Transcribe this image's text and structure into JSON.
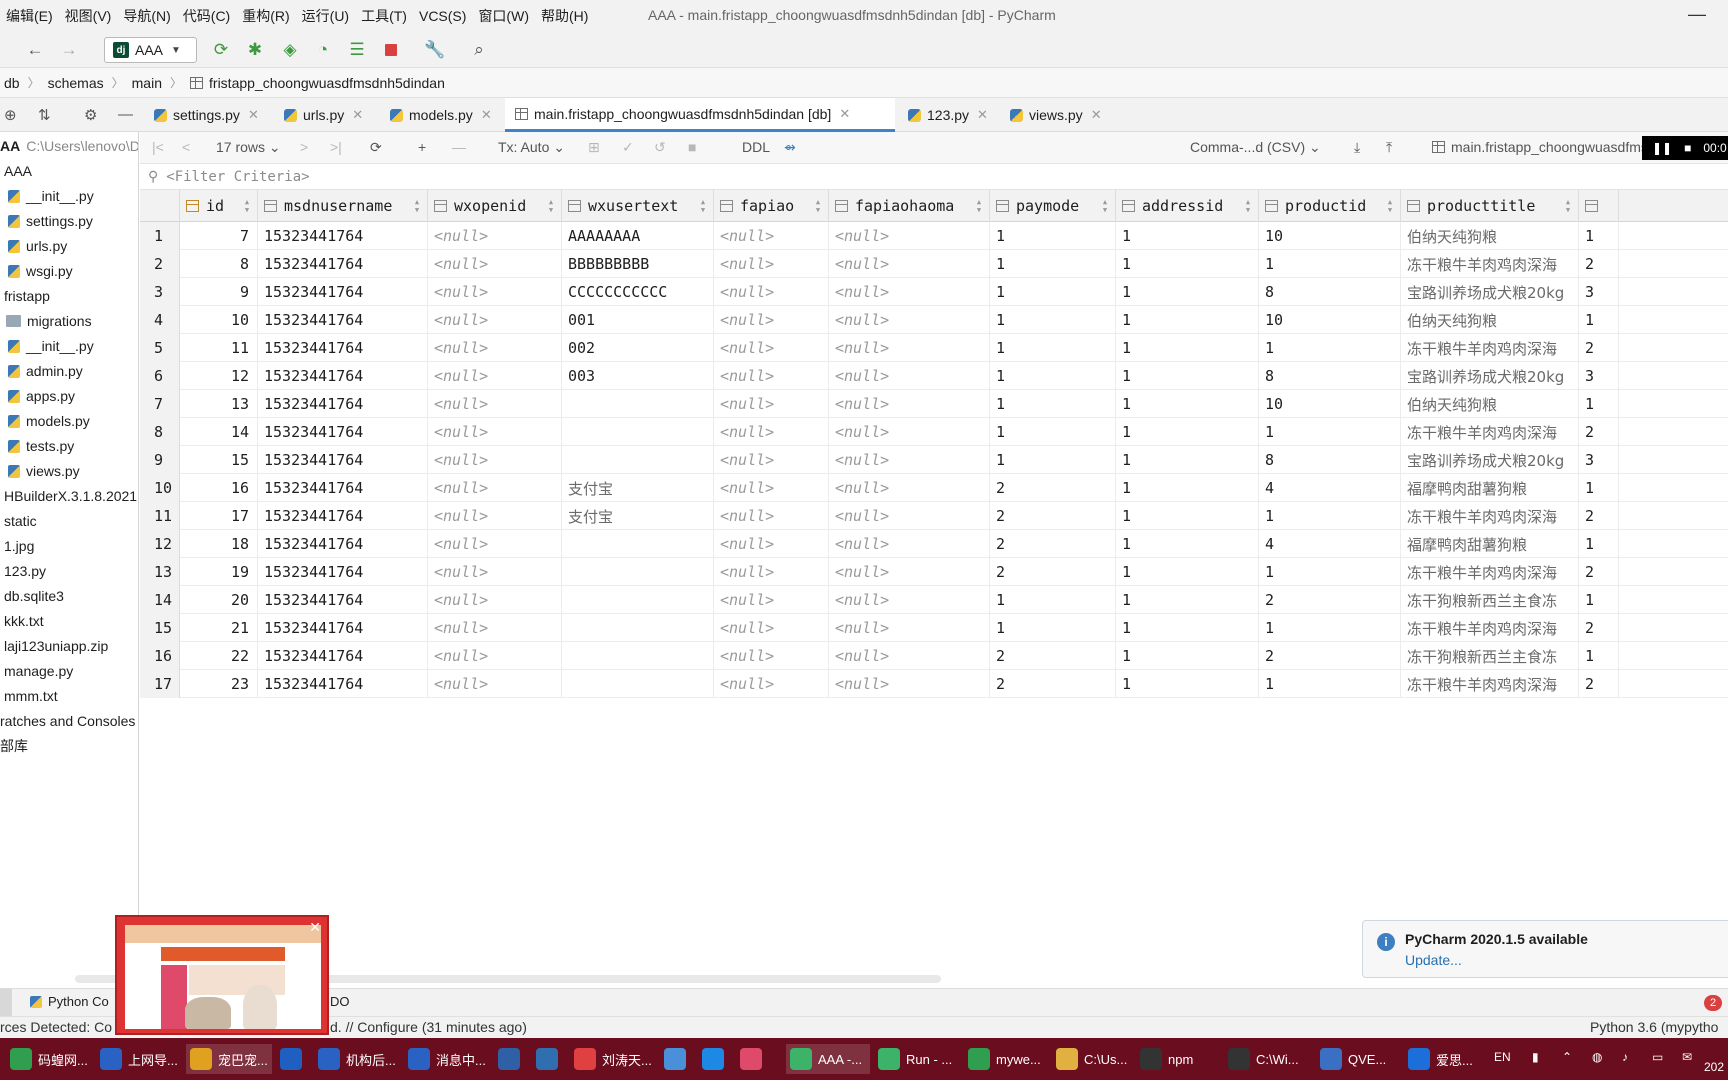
{
  "menu": {
    "items": [
      "编辑(E)",
      "视图(V)",
      "导航(N)",
      "代码(C)",
      "重构(R)",
      "运行(U)",
      "工具(T)",
      "VCS(S)",
      "窗口(W)",
      "帮助(H)"
    ],
    "window_title": "AAA - main.fristapp_choongwuasdfmsdnh5dindan [db] - PyCharm"
  },
  "toolbar": {
    "run_config": "AAA",
    "icons": [
      "back-icon",
      "forward-icon",
      "rerun-icon",
      "debug-icon",
      "coverage-icon",
      "profile-icon",
      "build-icon",
      "stop-icon",
      "wrench-icon",
      "search-icon"
    ]
  },
  "breadcrumb": [
    "db",
    "schemas",
    "main",
    "fristapp_choongwuasdfmsdnh5dindan"
  ],
  "tabs": [
    {
      "label": "settings.py",
      "active": false
    },
    {
      "label": "urls.py",
      "active": false
    },
    {
      "label": "models.py",
      "active": false
    },
    {
      "label": "main.fristapp_choongwuasdfmsdnh5dindan [db]",
      "active": true
    },
    {
      "label": "123.py",
      "active": false
    },
    {
      "label": "views.py",
      "active": false
    }
  ],
  "sidebar": {
    "root_label": "AA",
    "root_path": "C:\\Users\\lenovo\\D",
    "items": [
      "AAA",
      "__init__.py",
      "settings.py",
      "urls.py",
      "wsgi.py",
      "fristapp",
      "migrations",
      "__init__.py",
      "admin.py",
      "apps.py",
      "models.py",
      "tests.py",
      "views.py",
      "HBuilderX.3.1.8.2021",
      "static",
      "1.jpg",
      "123.py",
      "db.sqlite3",
      "kkk.txt",
      "laji123uniapp.zip",
      "manage.py",
      "mmm.txt",
      "ratches and Consoles",
      "部库"
    ]
  },
  "gridbar": {
    "rows_label": "17 rows",
    "tx_label": "Tx: Auto",
    "ddl_label": "DDL",
    "export_label": "Comma-...d (CSV)",
    "table_label": "main.fristapp_choongwuasdfmsd",
    "timer": "00:0"
  },
  "filter": {
    "placeholder": "<Filter Criteria>"
  },
  "grid": {
    "columns": [
      "id",
      "msdnusername",
      "wxopenid",
      "wxusertext",
      "fapiao",
      "fapiaohaoma",
      "paymode",
      "addressid",
      "productid",
      "producttitle"
    ],
    "rows": [
      [
        "7",
        "15323441764",
        "<null>",
        "AAAAAAAA",
        "<null>",
        "<null>",
        "1",
        "1",
        "10",
        "伯纳天纯狗粮",
        "1"
      ],
      [
        "8",
        "15323441764",
        "<null>",
        "BBBBBBBBB",
        "<null>",
        "<null>",
        "1",
        "1",
        "1",
        "冻干粮牛羊肉鸡肉深海",
        "2"
      ],
      [
        "9",
        "15323441764",
        "<null>",
        "CCCCCCCCCCC",
        "<null>",
        "<null>",
        "1",
        "1",
        "8",
        "宝路训养场成犬粮20kg",
        "3"
      ],
      [
        "10",
        "15323441764",
        "<null>",
        "001",
        "<null>",
        "<null>",
        "1",
        "1",
        "10",
        "伯纳天纯狗粮",
        "1"
      ],
      [
        "11",
        "15323441764",
        "<null>",
        "002",
        "<null>",
        "<null>",
        "1",
        "1",
        "1",
        "冻干粮牛羊肉鸡肉深海",
        "2"
      ],
      [
        "12",
        "15323441764",
        "<null>",
        "003",
        "<null>",
        "<null>",
        "1",
        "1",
        "8",
        "宝路训养场成犬粮20kg",
        "3"
      ],
      [
        "13",
        "15323441764",
        "<null>",
        "",
        "<null>",
        "<null>",
        "1",
        "1",
        "10",
        "伯纳天纯狗粮",
        "1"
      ],
      [
        "14",
        "15323441764",
        "<null>",
        "",
        "<null>",
        "<null>",
        "1",
        "1",
        "1",
        "冻干粮牛羊肉鸡肉深海",
        "2"
      ],
      [
        "15",
        "15323441764",
        "<null>",
        "",
        "<null>",
        "<null>",
        "1",
        "1",
        "8",
        "宝路训养场成犬粮20kg",
        "3"
      ],
      [
        "16",
        "15323441764",
        "<null>",
        "支付宝",
        "<null>",
        "<null>",
        "2",
        "1",
        "4",
        "福摩鸭肉甜薯狗粮",
        "1"
      ],
      [
        "17",
        "15323441764",
        "<null>",
        "支付宝",
        "<null>",
        "<null>",
        "2",
        "1",
        "1",
        "冻干粮牛羊肉鸡肉深海",
        "2"
      ],
      [
        "18",
        "15323441764",
        "<null>",
        "",
        "<null>",
        "<null>",
        "2",
        "1",
        "4",
        "福摩鸭肉甜薯狗粮",
        "1"
      ],
      [
        "19",
        "15323441764",
        "<null>",
        "",
        "<null>",
        "<null>",
        "2",
        "1",
        "1",
        "冻干粮牛羊肉鸡肉深海",
        "2"
      ],
      [
        "20",
        "15323441764",
        "<null>",
        "",
        "<null>",
        "<null>",
        "1",
        "1",
        "2",
        "冻干狗粮新西兰主食冻",
        "1"
      ],
      [
        "21",
        "15323441764",
        "<null>",
        "",
        "<null>",
        "<null>",
        "1",
        "1",
        "1",
        "冻干粮牛羊肉鸡肉深海",
        "2"
      ],
      [
        "22",
        "15323441764",
        "<null>",
        "",
        "<null>",
        "<null>",
        "2",
        "1",
        "2",
        "冻干狗粮新西兰主食冻",
        "1"
      ],
      [
        "23",
        "15323441764",
        "<null>",
        "",
        "<null>",
        "<null>",
        "2",
        "1",
        "1",
        "冻干粮牛羊肉鸡肉深海",
        "2"
      ]
    ]
  },
  "notification": {
    "title": "PyCharm 2020.1.5 available",
    "link": "Update..."
  },
  "bottom": {
    "python_console": "Python Co",
    "todo_fragment": "DO",
    "error_count": "2"
  },
  "status": {
    "left": "rces Detected: Co",
    "middle": "d. // Configure (31 minutes ago)",
    "right": "Python 3.6 (mypytho"
  },
  "taskbar": {
    "items": [
      "码蝗网...",
      "上网导...",
      "宠巴宠...",
      "",
      "机构后...",
      "消息中...",
      "",
      "",
      "刘涛天...",
      "",
      "",
      "",
      "AAA -...",
      "Run - ...",
      "mywe...",
      "C:\\Us...",
      "npm",
      "C:\\Wi...",
      "QVE...",
      "爱思..."
    ],
    "lang": "EN",
    "clock": "202"
  },
  "colors": {
    "accent": "#4083c9",
    "taskbar": "#6a0d1e",
    "null_text": "#9a9a9a"
  }
}
